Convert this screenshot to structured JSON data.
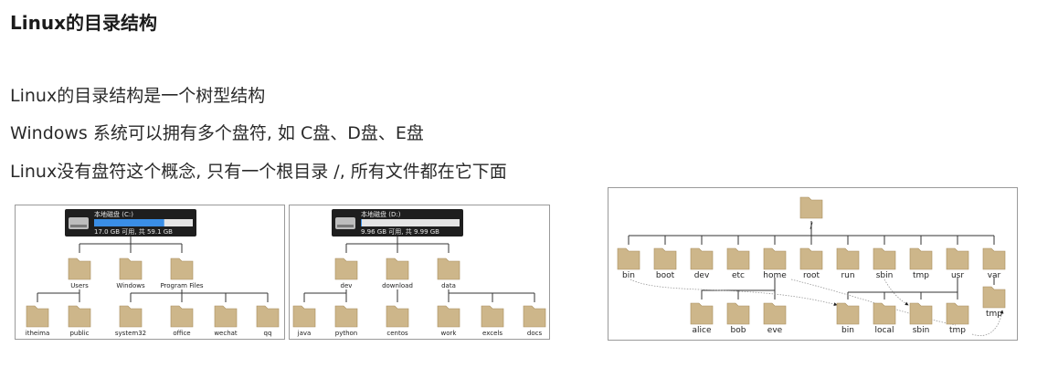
{
  "heading": "Linux的目录结构",
  "lines": [
    "Linux的目录结构是一个树型结构",
    "Windows 系统可以拥有多个盘符, 如 C盘、D盘、E盘",
    "Linux没有盘符这个概念, 只有一个根目录 /, 所有文件都在它下面"
  ],
  "win_c": {
    "drive_name": "本地磁盘 (C:)",
    "drive_usage": "17.0 GB 可用, 共 59.1 GB",
    "used_fraction": 0.71,
    "level1": [
      "Users",
      "Windows",
      "Program Files"
    ],
    "level2": [
      "itheima",
      "public",
      "system32",
      "office",
      "wechat",
      "qq"
    ]
  },
  "win_d": {
    "drive_name": "本地磁盘 (D:)",
    "drive_usage": "9.96 GB 可用, 共 9.99 GB",
    "used_fraction": 0.003,
    "level1": [
      "dev",
      "download",
      "data"
    ],
    "level2": [
      "java",
      "python",
      "centos",
      "work",
      "excels",
      "docs"
    ]
  },
  "linux": {
    "root": "/",
    "level1": [
      "bin",
      "boot",
      "dev",
      "etc",
      "home",
      "root",
      "run",
      "sbin",
      "tmp",
      "usr",
      "var"
    ],
    "home_children": [
      "alice",
      "bob",
      "eve"
    ],
    "usr_children": [
      "bin",
      "local",
      "sbin",
      "tmp"
    ],
    "var_children": [
      "tmp"
    ]
  },
  "colors": {
    "folder_body": "#cdb68a",
    "folder_tab": "#b89d6c",
    "drive_bar_fill": "#3a8ee6",
    "drive_bg": "#1e1e1e",
    "panel_border": "#9a9a9a"
  }
}
